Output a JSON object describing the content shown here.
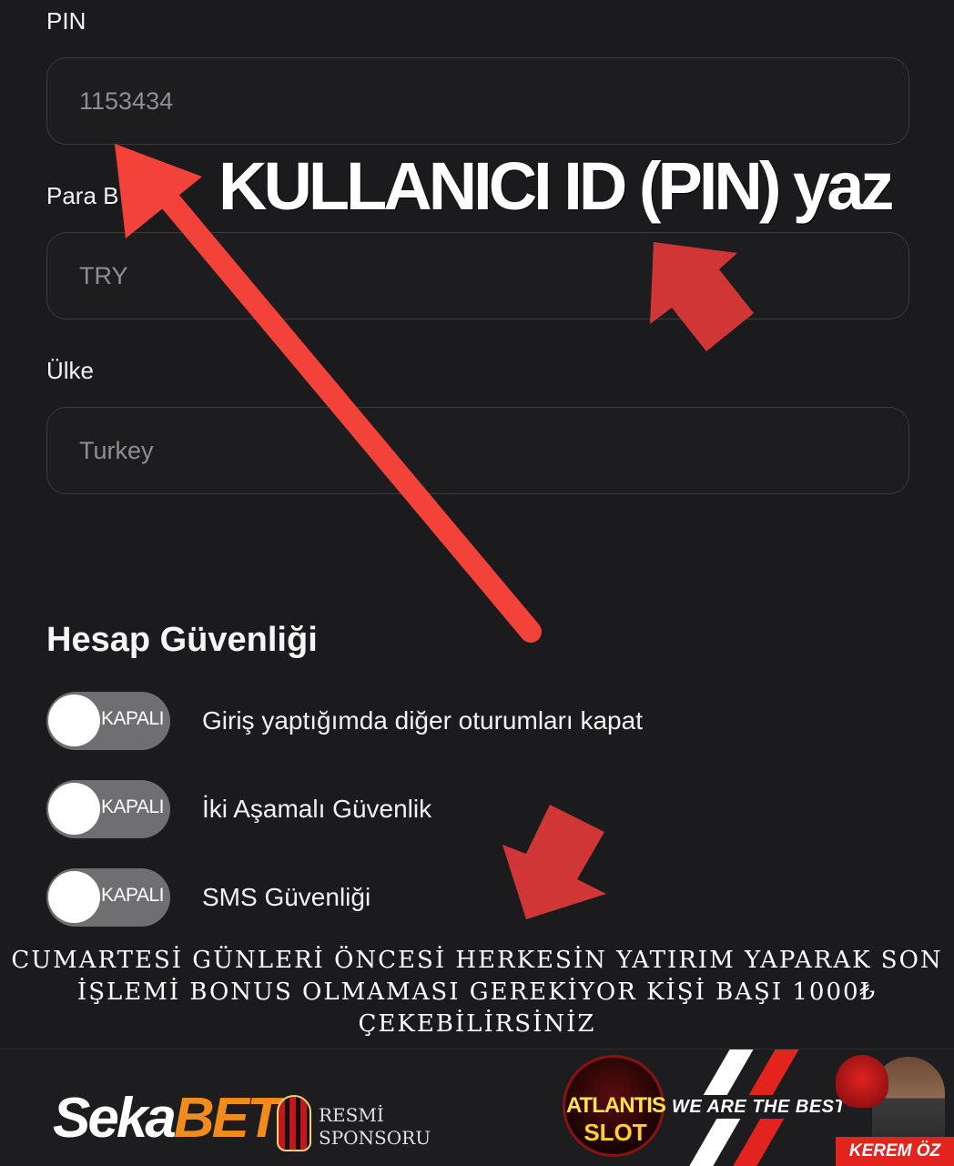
{
  "form": {
    "pin": {
      "label": "PIN",
      "value": "1153434"
    },
    "currency": {
      "label": "Para Birimi",
      "label_visible": "Para B",
      "value": "TRY"
    },
    "country": {
      "label": "Ülke",
      "value": "Turkey"
    }
  },
  "security": {
    "title": "Hesap Güvenliği",
    "toggles": [
      {
        "label": "Giriş yaptığımda diğer oturumları kapat",
        "state": "KAPALI"
      },
      {
        "label": "İki Aşamalı Güvenlik",
        "state": "KAPALI"
      },
      {
        "label": "SMS Güvenliği",
        "state": "KAPALI"
      }
    ]
  },
  "annotation": {
    "headline": "KULLANICI ID (PIN) yaz",
    "arrow_color": "#f2423a",
    "notice": "CUMARTESİ GÜNLERİ ÖNCESİ HERKESİN YATIRIM YAPARAK SON İŞLEMİ BONUS OLMAMASI GEREKİYOR KİŞİ BAŞI 1000₺ ÇEKEBİLİRSİNİZ"
  },
  "footer": {
    "brand_part1": "Seka",
    "brand_part2": "BET",
    "brand_accent": "#f08b1c",
    "sponsor_line1": "RESMİ",
    "sponsor_line2": "SPONSORU",
    "slot_line1": "ATLANTIS",
    "slot_line2": "SLOT",
    "motto": "WE ARE THE BEST",
    "name_tag": "KEREM ÖZ"
  }
}
